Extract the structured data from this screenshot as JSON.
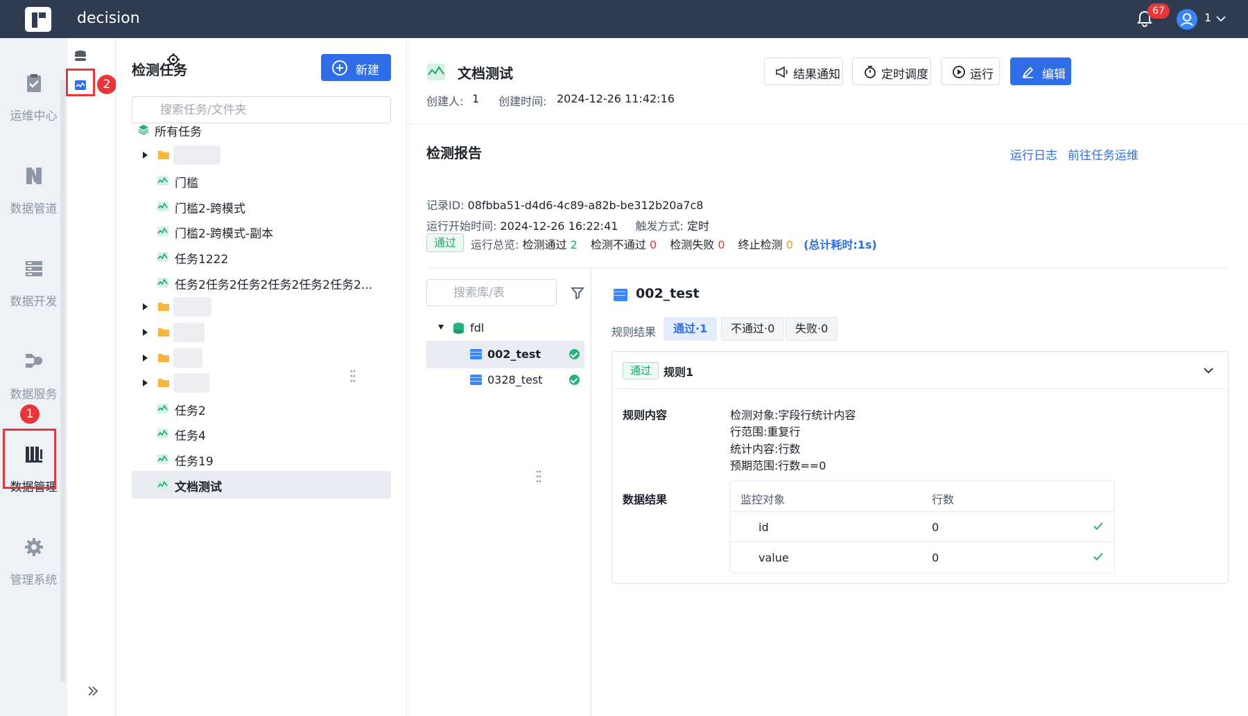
{
  "header": {
    "app_name": "decision",
    "notification_count": "67",
    "user_name": "1"
  },
  "rail": {
    "items": [
      {
        "label": "运维中心",
        "icon": "clipboard-check-icon"
      },
      {
        "label": "数据管道",
        "icon": "pipeline-icon"
      },
      {
        "label": "数据开发",
        "icon": "server-stack-icon"
      },
      {
        "label": "数据服务",
        "icon": "service-network-icon"
      },
      {
        "label": "数据管理",
        "icon": "data-manage-icon",
        "active": true
      },
      {
        "label": "管理系统",
        "icon": "gear-icon"
      }
    ],
    "step1": "1",
    "step2": "2"
  },
  "tree_panel": {
    "title": "检测任务",
    "new_button": "新建",
    "search_placeholder": "搜索任务/文件夹",
    "root": "所有任务",
    "items": [
      "门槛",
      "门槛2-跨模式",
      "门槛2-跨模式-副本",
      "任务1222",
      "任务2任务2任务2任务2任务2任务2...",
      "任务2",
      "任务4",
      "任务19",
      "文档测试"
    ]
  },
  "task": {
    "title": "文档测试",
    "creator_label": "创建人:",
    "creator": "1",
    "created_label": "创建时间:",
    "created_at": "2024-12-26 11:42:16",
    "buttons": {
      "notify": "结果通知",
      "schedule": "定时调度",
      "run": "运行",
      "edit": "编辑"
    }
  },
  "report": {
    "title": "检测报告",
    "links": {
      "log": "运行日志",
      "goto": "前往任务运维"
    },
    "record_label": "记录ID:",
    "record_id": "08fbba51-d4d6-4c89-a82b-be312b20a7c8",
    "start_label": "运行开始时间:",
    "start_time": "2024-12-26 16:22:41",
    "trigger_label": "触发方式:",
    "trigger": "定时",
    "status": "通过",
    "summary_label": "运行总览:",
    "pass_label": "检测通过",
    "pass_count": "2",
    "fail_label": "检测不通过",
    "fail_count": "0",
    "error_label": "检测失败",
    "error_count": "0",
    "stop_label": "终止检测",
    "stop_count": "0",
    "total_time": "(总计耗时:1s)"
  },
  "lib_panel": {
    "search_placeholder": "搜索库/表",
    "db": "fdl",
    "tables": [
      "002_test",
      "0328_test"
    ]
  },
  "result": {
    "table": "002_test",
    "rule_result_label": "规则结果",
    "chips": [
      "通过·1",
      "不通过·0",
      "失败·0"
    ],
    "rule": {
      "status": "通过",
      "name": "规则1",
      "content_title": "规则内容",
      "content_lines": [
        "检测对象:字段行统计内容",
        "行范围:重复行",
        "统计内容:行数",
        "预期范围:行数==0"
      ],
      "data_title": "数据结果",
      "columns": [
        "监控对象",
        "行数"
      ],
      "rows": [
        {
          "name": "id",
          "value": "0"
        },
        {
          "name": "value",
          "value": "0"
        }
      ]
    }
  }
}
